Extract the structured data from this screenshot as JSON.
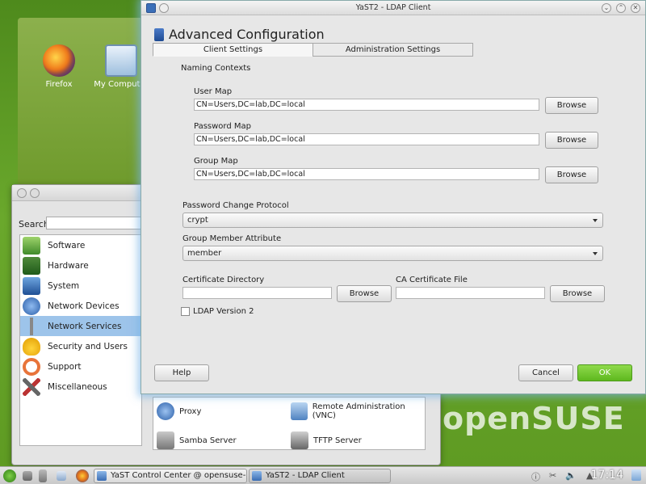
{
  "desktop": {
    "icons": [
      {
        "label": "Firefox",
        "icon": "firefox-icon"
      },
      {
        "label": "My Computer",
        "icon": "computer-icon"
      }
    ],
    "brand_text": "openSUSE"
  },
  "control_center": {
    "search_label": "Search",
    "categories": [
      {
        "label": "Software",
        "icon": "software-icon"
      },
      {
        "label": "Hardware",
        "icon": "hardware-icon"
      },
      {
        "label": "System",
        "icon": "system-icon"
      },
      {
        "label": "Network Devices",
        "icon": "network-devices-icon"
      },
      {
        "label": "Network Services",
        "icon": "network-services-icon",
        "selected": true
      },
      {
        "label": "Security and Users",
        "icon": "security-icon"
      },
      {
        "label": "Support",
        "icon": "support-icon"
      },
      {
        "label": "Miscellaneous",
        "icon": "misc-icon"
      }
    ],
    "modules": [
      {
        "label": "Proxy",
        "icon": "proxy-icon"
      },
      {
        "label": "Remote Administration (VNC)",
        "icon": "vnc-icon"
      },
      {
        "label": "Samba Server",
        "icon": "samba-icon"
      },
      {
        "label": "TFTP Server",
        "icon": "tftp-icon"
      }
    ]
  },
  "dialog": {
    "window_title": "YaST2 - LDAP Client",
    "heading": "Advanced Configuration",
    "tabs": [
      {
        "label": "Client Settings",
        "active": true
      },
      {
        "label": "Administration Settings",
        "active": false
      }
    ],
    "naming_contexts_label": "Naming Contexts",
    "user_map": {
      "label": "User Map",
      "value": "CN=Users,DC=lab,DC=local",
      "button": "Browse"
    },
    "password_map": {
      "label": "Password Map",
      "value": "CN=Users,DC=lab,DC=local",
      "button": "Browse"
    },
    "group_map": {
      "label": "Group Map",
      "value": "CN=Users,DC=lab,DC=local",
      "button": "Browse"
    },
    "password_change_protocol": {
      "label": "Password Change Protocol",
      "value": "crypt"
    },
    "group_member_attribute": {
      "label": "Group Member Attribute",
      "value": "member"
    },
    "certificate_directory": {
      "label": "Certificate Directory",
      "value": "",
      "button": "Browse"
    },
    "ca_certificate_file": {
      "label": "CA Certificate File",
      "value": "",
      "button": "Browse"
    },
    "ldap_version2": {
      "label": "LDAP Version 2",
      "checked": false
    },
    "help_button": "Help",
    "cancel_button": "Cancel",
    "ok_button": "OK"
  },
  "taskbar": {
    "tasks": [
      {
        "label": "YaST Control Center @ opensuse-test",
        "active": false
      },
      {
        "label": "YaST2 - LDAP Client",
        "active": true
      }
    ],
    "clock": "17:14"
  }
}
